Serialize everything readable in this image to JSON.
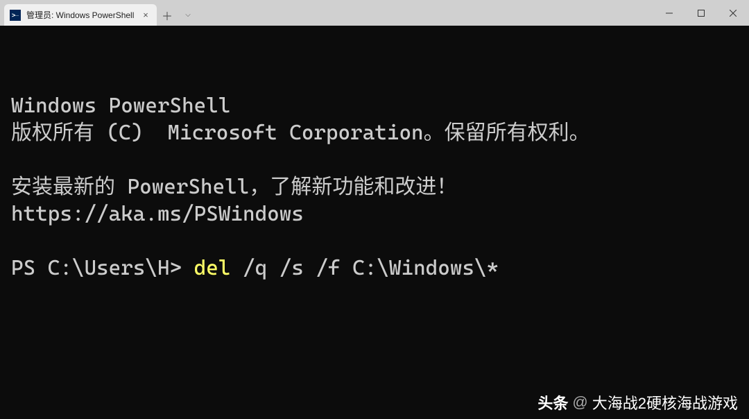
{
  "titlebar": {
    "tab_title": "管理员: Windows PowerShell",
    "new_tab": "＋",
    "dropdown": "⌵",
    "tab_close": "×"
  },
  "terminal": {
    "header": "Windows PowerShell",
    "copyright": "版权所有 (C)  Microsoft Corporation。保留所有权利。",
    "install_msg": "安装最新的 PowerShell，了解新功能和改进！",
    "install_url": "https://aka.ms/PSWindows",
    "prompt": "PS C:\\Users\\H> ",
    "cmd_keyword": "del",
    "cmd_args": " /q /s /f C:\\Windows\\*"
  },
  "watermark": {
    "logo": "头条",
    "at": "@",
    "handle": "大海战2硬核海战游戏"
  }
}
